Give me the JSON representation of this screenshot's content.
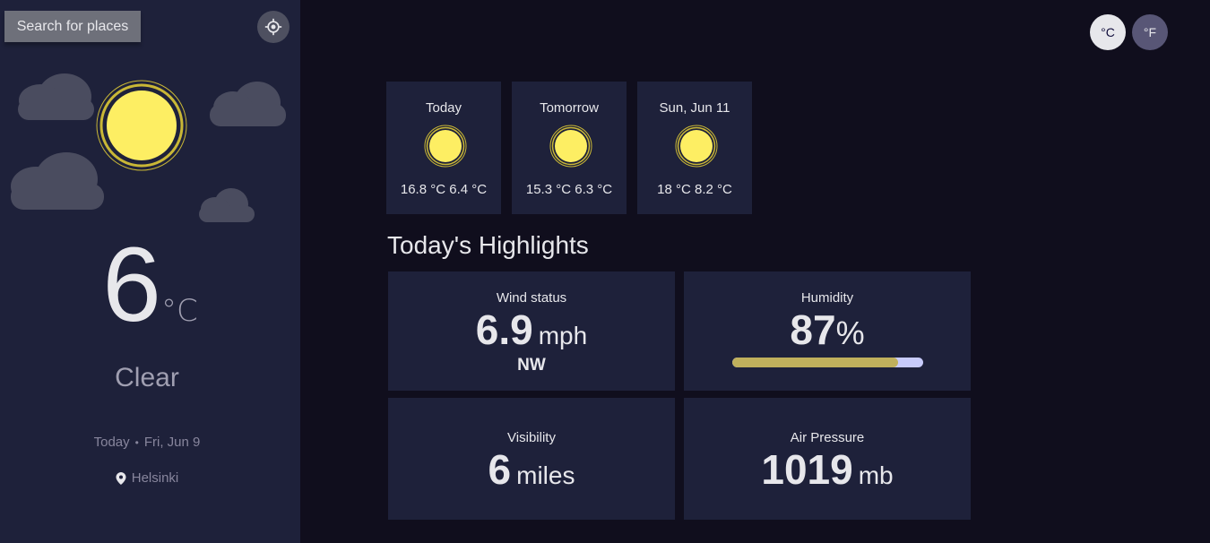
{
  "sidebar": {
    "search_label": "Search for places",
    "locate_icon": "crosshair-icon",
    "current_temp": "6",
    "temp_unit": "°C",
    "condition": "Clear",
    "date_prefix": "Today",
    "date_separator": "•",
    "date": "Fri, Jun 9",
    "location": "Helsinki",
    "location_icon": "map-pin-icon"
  },
  "units": {
    "celsius_label": "°C",
    "fahrenheit_label": "°F"
  },
  "forecast": [
    {
      "day": "Today",
      "max": "16.8 °C",
      "min": "6.4 °C",
      "icon": "sun-icon"
    },
    {
      "day": "Tomorrow",
      "max": "15.3 °C",
      "min": "6.3 °C",
      "icon": "sun-icon"
    },
    {
      "day": "Sun, Jun 11",
      "max": "18 °C",
      "min": "8.2 °C",
      "icon": "sun-icon"
    }
  ],
  "highlights": {
    "title": "Today's Highlights",
    "wind": {
      "label": "Wind status",
      "value": "6.9",
      "unit": "mph",
      "direction": "NW"
    },
    "humidity": {
      "label": "Humidity",
      "value": "87",
      "unit": "%",
      "percent": 87
    },
    "visibility": {
      "label": "Visibility",
      "value": "6",
      "unit": "miles"
    },
    "pressure": {
      "label": "Air Pressure",
      "value": "1019",
      "unit": "mb"
    }
  },
  "colors": {
    "sun": "#fdee63",
    "sun_ring": "#c9b736",
    "cloud": "#4d4f61",
    "sidebar_bg": "#1e213a",
    "page_bg": "#100e1d",
    "humidity_fill": "#c0b05c",
    "humidity_track": "#c8cbfb"
  }
}
